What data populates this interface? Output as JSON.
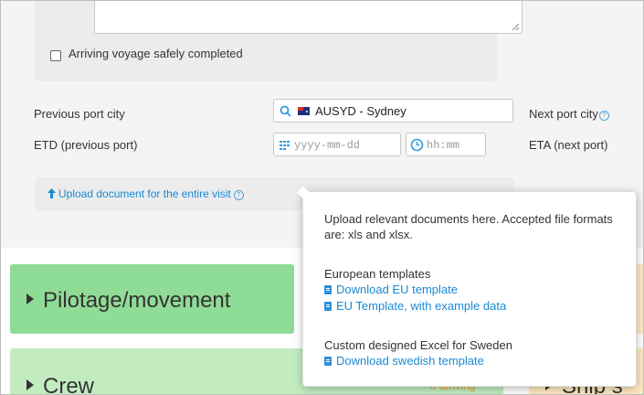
{
  "voyage": {
    "checkbox_label": "Arriving voyage safely completed"
  },
  "ports": {
    "previous_label": "Previous port city",
    "previous_value": "AUSYD - Sydney",
    "next_label": "Next port city",
    "etd_label": "ETD (previous port)",
    "eta_label": "ETA (next port)",
    "date_placeholder": "yyyy-mm-dd",
    "time_placeholder": "hh:mm"
  },
  "upload": {
    "link_label": "Upload document for the entire visit"
  },
  "tooltip": {
    "intro": "Upload relevant documents here. Accepted file formats are: xls and xlsx.",
    "eu_heading": "European templates",
    "eu_download": "Download EU template",
    "eu_example": "EU Template, with example data",
    "se_heading": "Custom designed Excel for Sweden",
    "se_download": "Download swedish template"
  },
  "panels": {
    "pilotage_title": "Pilotage/movement",
    "pilotage_right_fragment": "s",
    "crew_title": "Crew",
    "crew_badge": "0 arriving",
    "ship_fragment": "Ship s"
  },
  "colors": {
    "accent_blue": "#1a8ad4",
    "pilotage_green": "#8fdc96",
    "crew_green": "#c2ecc0",
    "amber": "#ffe9bf",
    "badge_orange": "#f0a030"
  }
}
